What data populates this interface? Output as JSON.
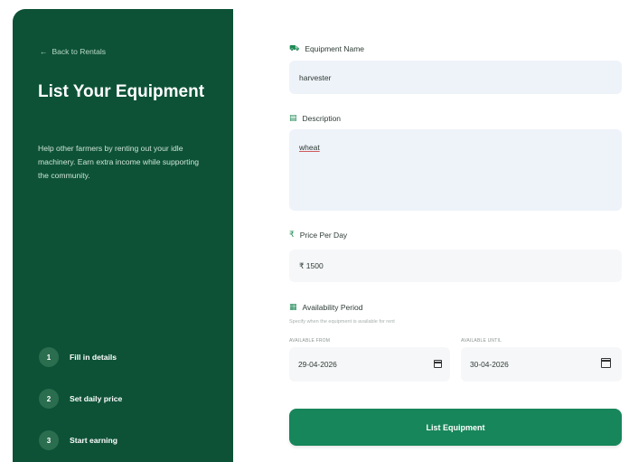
{
  "sidebar": {
    "back_label": "Back to Rentals",
    "title": "List Your Equipment",
    "description": "Help other farmers by renting out your idle machinery. Earn extra income while supporting the community.",
    "steps": [
      {
        "num": "1",
        "label": "Fill in details"
      },
      {
        "num": "2",
        "label": "Set daily price"
      },
      {
        "num": "3",
        "label": "Start earning"
      }
    ]
  },
  "form": {
    "name_label": "Equipment Name",
    "name_value": "harvester",
    "description_label": "Description",
    "description_value": "wheat",
    "price_label": "Price Per Day",
    "price_value": "₹ 1500",
    "availability_label": "Availability Period",
    "availability_hint": "Specify when the equipment is available for rent",
    "from_label": "AVAILABLE FROM",
    "from_value": "29-04-2026",
    "until_label": "AVAILABLE UNTIL",
    "until_value": "30-04-2026",
    "submit_label": "List Equipment"
  },
  "colors": {
    "sidebar": "#0d5237",
    "accent": "#17865a",
    "input": "#eef2f9"
  }
}
